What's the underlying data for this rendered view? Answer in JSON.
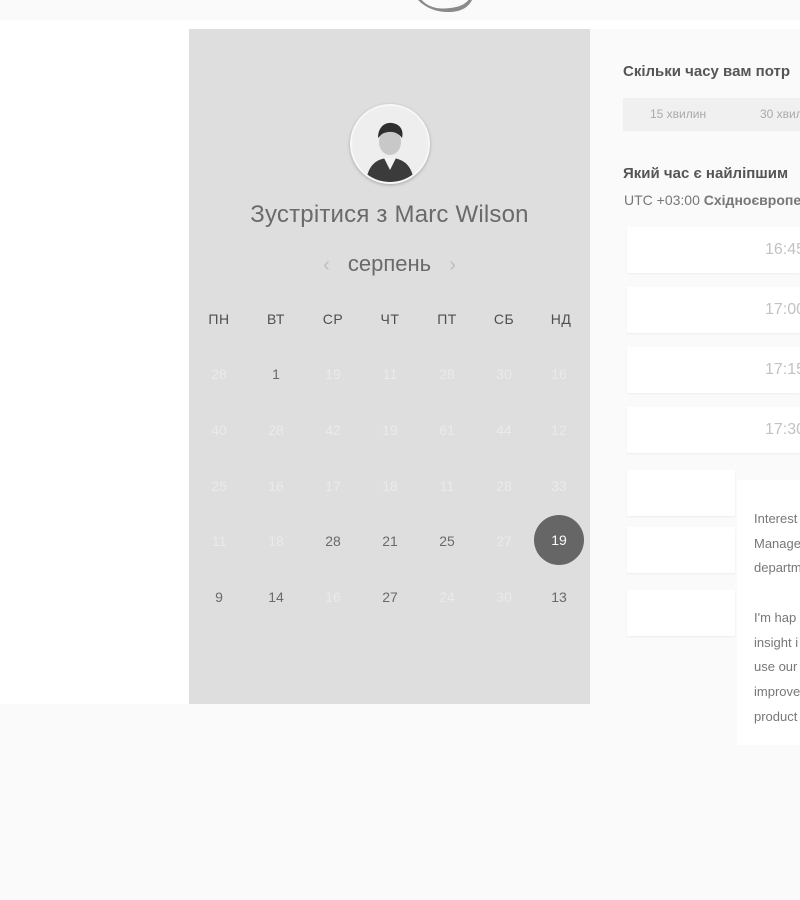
{
  "header": {
    "logo_icon": "logo-icon"
  },
  "host": {
    "avatar_icon": "avatar-icon",
    "title": "Зустрітися з Marc Wilson"
  },
  "calendar": {
    "month": "серпень",
    "prev_icon": "chevron-left-icon",
    "next_icon": "chevron-right-icon",
    "weekdays": [
      "ПН",
      "ВТ",
      "СР",
      "ЧТ",
      "ПТ",
      "СБ",
      "НД"
    ],
    "weeks": [
      [
        "28",
        "1",
        "19",
        "11",
        "28",
        "30",
        "16"
      ],
      [
        "40",
        "28",
        "42",
        "19",
        "61",
        "44",
        "12"
      ],
      [
        "25",
        "16",
        "17",
        "18",
        "11",
        "28",
        "33"
      ],
      [
        "11",
        "18",
        "28",
        "21",
        "25",
        "27",
        "19"
      ],
      [
        "9",
        "14",
        "16",
        "27",
        "24",
        "30",
        "13"
      ]
    ],
    "selected": "19"
  },
  "duration": {
    "question": "Скільки часу вам потр",
    "options": [
      "15 хвилин",
      "30 хвил"
    ]
  },
  "time": {
    "question": "Який час є найліпшим",
    "tz_offset": "UTC +03:00",
    "tz_name": "Східноєвропе",
    "slots": [
      "16:45",
      "17:00",
      "17:15",
      "17:30"
    ]
  },
  "popup": {
    "lines": [
      "Interest",
      "Manage",
      "departm",
      "",
      "I'm hap",
      "insight i",
      "use our",
      "improve",
      "product"
    ]
  }
}
